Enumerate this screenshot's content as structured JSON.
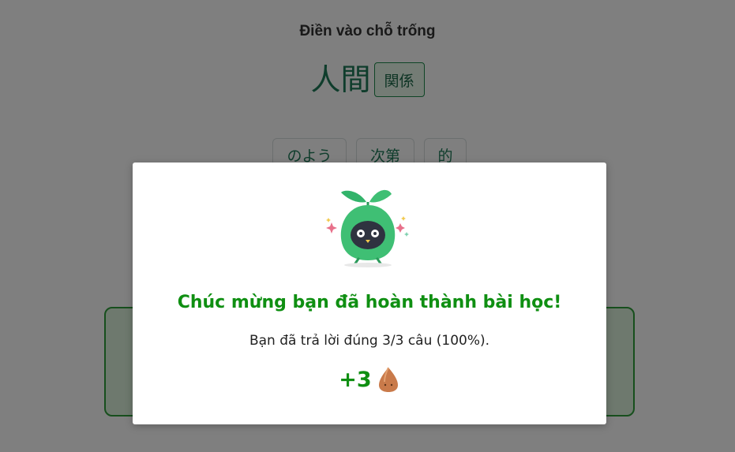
{
  "exercise": {
    "instruction": "Điền vào chỗ trống",
    "question_text": "人間",
    "filled_answer": "関係",
    "choices": [
      "のよう",
      "次第",
      "的"
    ]
  },
  "modal": {
    "mascot_icon": "sprout-mascot-icon",
    "title": "Chúc mừng bạn đã hoàn thành bài học!",
    "message": "Bạn đã trả lời đúng 3/3 câu (100%).",
    "reward_amount": "+3",
    "reward_icon": "seed-icon"
  },
  "colors": {
    "accent_green": "#0f8f12",
    "text_teal": "#1e7a58",
    "overlay": "rgba(0,0,0,0.5)"
  }
}
